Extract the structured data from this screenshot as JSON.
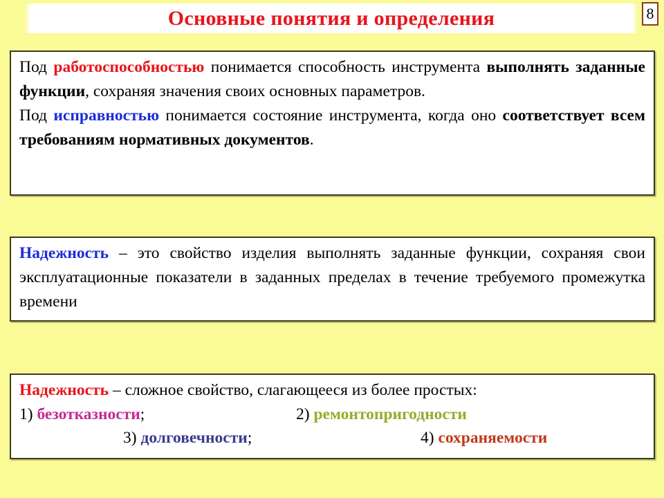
{
  "slide": {
    "background_color": "#fafa96",
    "title": "Основные понятия и определения",
    "title_color": "#e8141b",
    "page_number": "8"
  },
  "block1": {
    "line1_a": "Под ",
    "line1_term": "работоспособностью",
    "line1_b": " понимается способность инструмента ",
    "line1_bold": "выполнять заданные функции",
    "line1_c": ", сохраняя значения своих основных параметров.",
    "line2_a": "Под ",
    "line2_term": "исправностью",
    "line2_b": " понимается состояние инструмента, когда оно ",
    "line2_bold": "соответствует всем требованиям нормативных документов",
    "line2_c": "."
  },
  "block2": {
    "term": "Надежность",
    "text": " – это свойство изделия выполнять заданные функции, сохраняя свои эксплуатационные показатели в заданных пределах в течение требуемого промежутка времени"
  },
  "block3": {
    "term": "Надежность",
    "intro": " – сложное свойство, слагающееся из более простых:",
    "items": [
      {
        "number": "1)",
        "label": "безотказности",
        "suffix": ";",
        "color": "#c42a96"
      },
      {
        "number": "2)",
        "label": "ремонтопригодности",
        "suffix": "",
        "color": "#9aaa2c"
      },
      {
        "number": "3)",
        "label": "долговечности",
        "suffix": ";",
        "color": "#3b3b8f"
      },
      {
        "number": "4)",
        "label": "сохраняемости",
        "suffix": "",
        "color": "#c0391b"
      }
    ]
  },
  "colors": {
    "red": "#e8141b",
    "blue": "#1c2cd8",
    "magenta": "#c42a96",
    "olive": "#9aaa2c",
    "violet": "#3b3b8f",
    "brick": "#c0391b",
    "border": "#3a3a1e",
    "page_box_border": "#8b3a26"
  }
}
